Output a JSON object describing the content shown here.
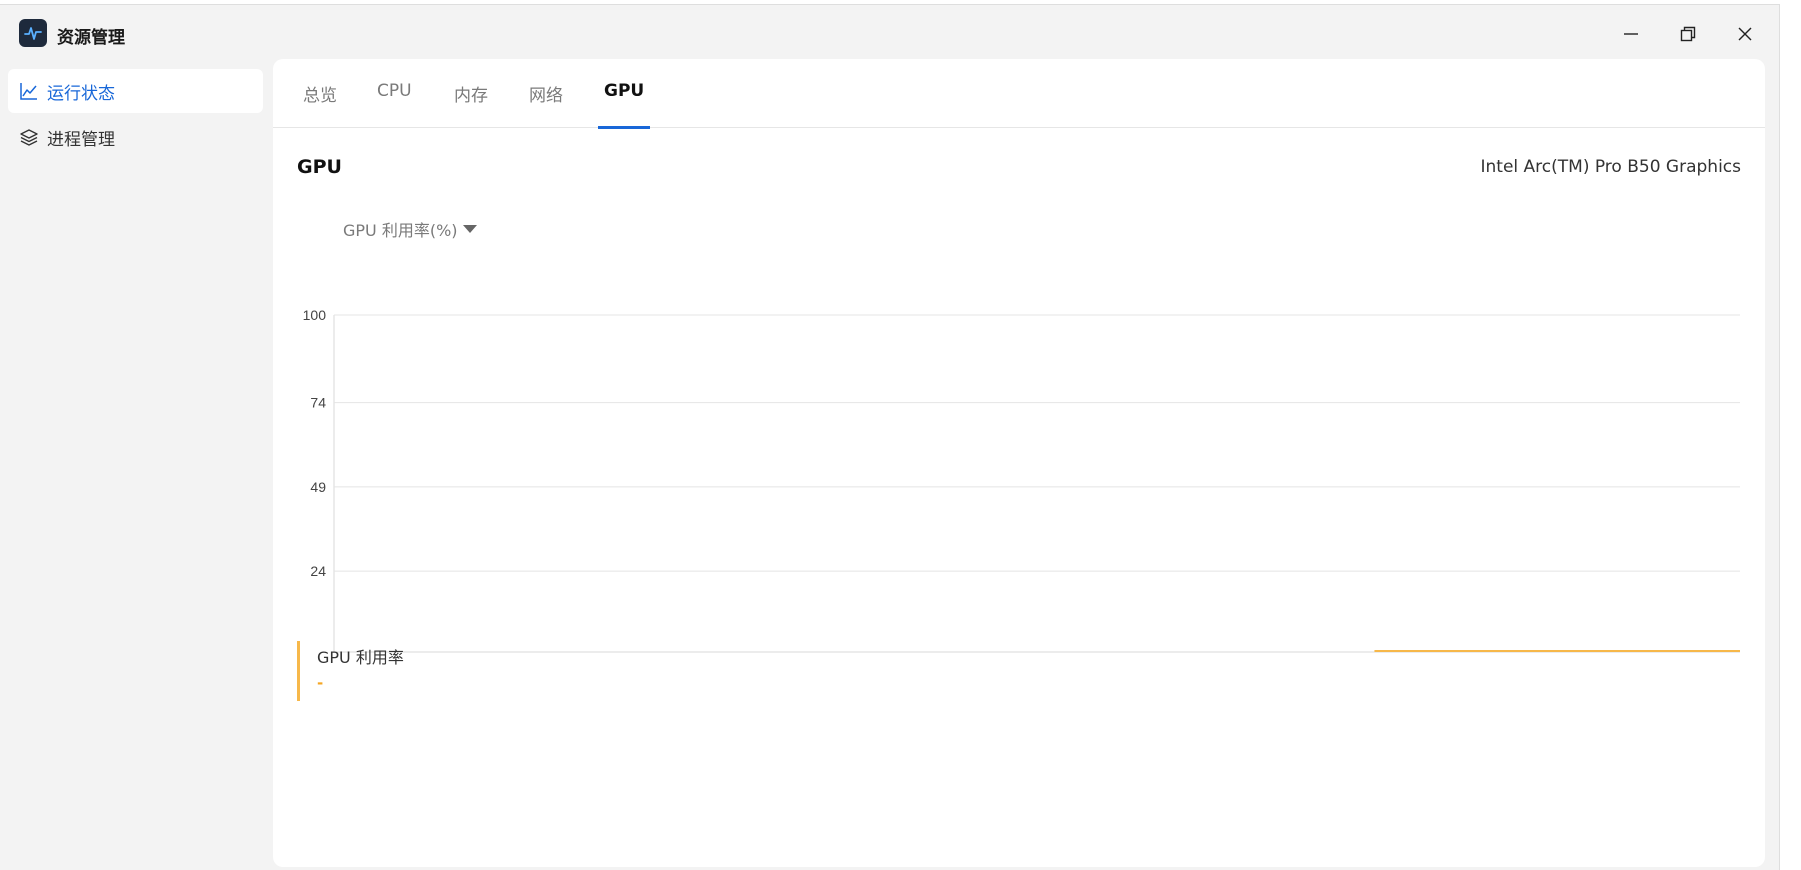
{
  "app": {
    "title": "资源管理"
  },
  "sidebar": {
    "items": [
      {
        "label": "运行状态",
        "icon": "line-chart-icon",
        "active": true
      },
      {
        "label": "进程管理",
        "icon": "layers-icon",
        "active": false
      }
    ]
  },
  "tabs": [
    {
      "label": "总览",
      "active": false
    },
    {
      "label": "CPU",
      "active": false
    },
    {
      "label": "内存",
      "active": false
    },
    {
      "label": "网络",
      "active": false
    },
    {
      "label": "GPU",
      "active": true
    }
  ],
  "gpu": {
    "heading": "GPU",
    "model": "Intel Arc(TM) Pro B50 Graphics",
    "metric_selector": "GPU 利用率(%)"
  },
  "legend": {
    "name": "GPU 利用率",
    "value": "-"
  },
  "colors": {
    "accent": "#1867d8",
    "series": "#f7b84a"
  },
  "chart_data": {
    "type": "line",
    "title": "",
    "ylabel": "",
    "xlabel": "",
    "ylim": [
      0,
      100
    ],
    "yticks": [
      100,
      74,
      49,
      24
    ],
    "grid": true,
    "series": [
      {
        "name": "GPU 利用率",
        "x": [
          0.74,
          1.0
        ],
        "values": [
          0,
          0
        ]
      }
    ]
  }
}
